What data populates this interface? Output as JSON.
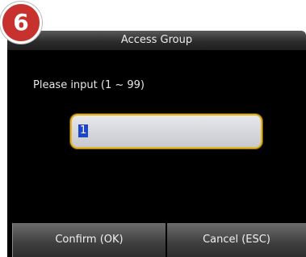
{
  "badge": {
    "number": "6",
    "color": "#c8322e"
  },
  "window": {
    "title": "Access Group"
  },
  "form": {
    "prompt": "Please input (1 ~ 99)",
    "input_value": "1",
    "accent": "#e6b320"
  },
  "buttons": {
    "confirm": "Confirm (OK)",
    "cancel": "Cancel (ESC)"
  }
}
